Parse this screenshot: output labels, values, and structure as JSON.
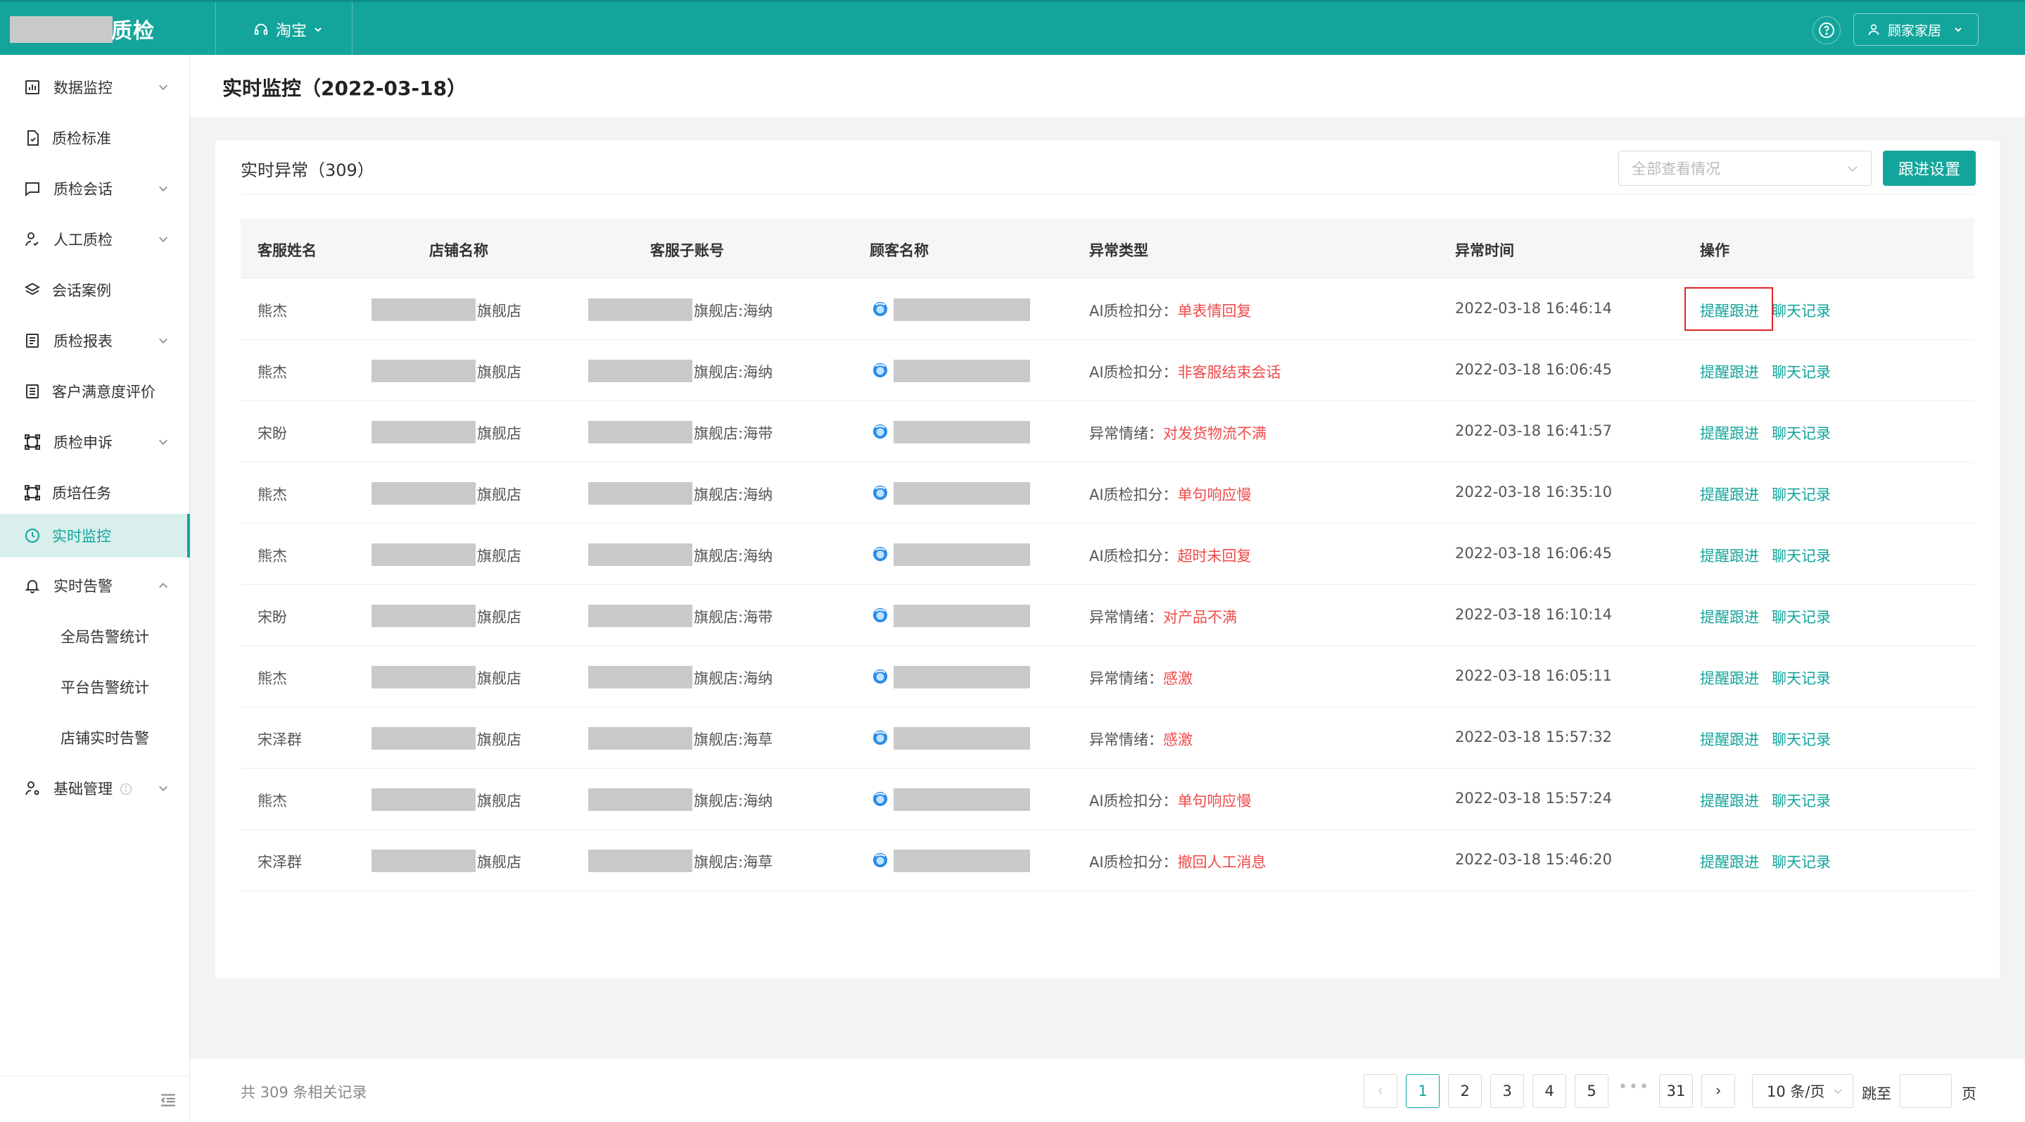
{
  "header": {
    "app_title": "质检",
    "platform": "淘宝",
    "user": "顾家家居"
  },
  "sidebar": {
    "items": [
      {
        "label": "数据监控",
        "icon": "bar-chart-icon",
        "expandable": true
      },
      {
        "label": "质检标准",
        "icon": "document-icon",
        "expandable": false
      },
      {
        "label": "质检会话",
        "icon": "message-icon",
        "expandable": true
      },
      {
        "label": "人工质检",
        "icon": "user-check-icon",
        "expandable": true
      },
      {
        "label": "会话案例",
        "icon": "layers-icon",
        "expandable": false
      },
      {
        "label": "质检报表",
        "icon": "report-icon",
        "expandable": true
      },
      {
        "label": "客户满意度评价",
        "icon": "form-icon",
        "expandable": false
      },
      {
        "label": "质检申诉",
        "icon": "appeal-icon",
        "expandable": true
      },
      {
        "label": "质培任务",
        "icon": "task-icon",
        "expandable": false
      },
      {
        "label": "实时监控",
        "icon": "clock-icon",
        "expandable": false,
        "active": true
      },
      {
        "label": "实时告警",
        "icon": "bell-icon",
        "expandable": true,
        "expanded": true
      },
      {
        "label": "全局告警统计",
        "sub": true
      },
      {
        "label": "平台告警统计",
        "sub": true
      },
      {
        "label": "店铺实时告警",
        "sub": true
      },
      {
        "label": "基础管理",
        "icon": "user-settings-icon",
        "expandable": true
      }
    ]
  },
  "page": {
    "title": "实时监控（2022-03-18）"
  },
  "card": {
    "title": "实时异常（309）",
    "filter_placeholder": "全部查看情况",
    "follow_button": "跟进设置"
  },
  "table": {
    "columns": [
      "客服姓名",
      "店铺名称",
      "客服子账号",
      "顾客名称",
      "异常类型",
      "异常时间",
      "操作"
    ],
    "rows": [
      {
        "agent": "熊杰",
        "shop": "旗舰店",
        "account": "旗舰店:海纳",
        "type": "AI质检扣分：",
        "detail": "单表情回复",
        "time": "2022-03-18 16:46:14"
      },
      {
        "agent": "熊杰",
        "shop": "旗舰店",
        "account": "旗舰店:海纳",
        "type": "AI质检扣分：",
        "detail": "非客服结束会话",
        "time": "2022-03-18 16:06:45"
      },
      {
        "agent": "宋盼",
        "shop": "旗舰店",
        "account": "旗舰店:海带",
        "type": "异常情绪：",
        "detail": "对发货物流不满",
        "time": "2022-03-18 16:41:57"
      },
      {
        "agent": "熊杰",
        "shop": "旗舰店",
        "account": "旗舰店:海纳",
        "type": "AI质检扣分：",
        "detail": "单句响应慢",
        "time": "2022-03-18 16:35:10"
      },
      {
        "agent": "熊杰",
        "shop": "旗舰店",
        "account": "旗舰店:海纳",
        "type": "AI质检扣分：",
        "detail": "超时未回复",
        "time": "2022-03-18 16:06:45"
      },
      {
        "agent": "宋盼",
        "shop": "旗舰店",
        "account": "旗舰店:海带",
        "type": "异常情绪：",
        "detail": "对产品不满",
        "time": "2022-03-18 16:10:14"
      },
      {
        "agent": "熊杰",
        "shop": "旗舰店",
        "account": "旗舰店:海纳",
        "type": "异常情绪：",
        "detail": "感激",
        "time": "2022-03-18 16:05:11"
      },
      {
        "agent": "宋泽群",
        "shop": "旗舰店",
        "account": "旗舰店:海草",
        "type": "异常情绪：",
        "detail": "感激",
        "time": "2022-03-18 15:57:32"
      },
      {
        "agent": "熊杰",
        "shop": "旗舰店",
        "account": "旗舰店:海纳",
        "type": "AI质检扣分：",
        "detail": "单句响应慢",
        "time": "2022-03-18 15:57:24"
      },
      {
        "agent": "宋泽群",
        "shop": "旗舰店",
        "account": "旗舰店:海草",
        "type": "AI质检扣分：",
        "detail": "撤回人工消息",
        "time": "2022-03-18 15:46:20"
      }
    ],
    "action_remind": "提醒跟进",
    "action_chat": "聊天记录"
  },
  "pagination": {
    "total": "共 309 条相关记录",
    "pages": [
      "1",
      "2",
      "3",
      "4",
      "5"
    ],
    "ellipsis": "•••",
    "last": "31",
    "current": "1",
    "page_size": "10 条/页",
    "jump_label": "跳至",
    "jump_unit": "页"
  },
  "colors": {
    "brand": "#13a59c",
    "alert": "#f04a4a",
    "highlight_box": "#e02424"
  }
}
